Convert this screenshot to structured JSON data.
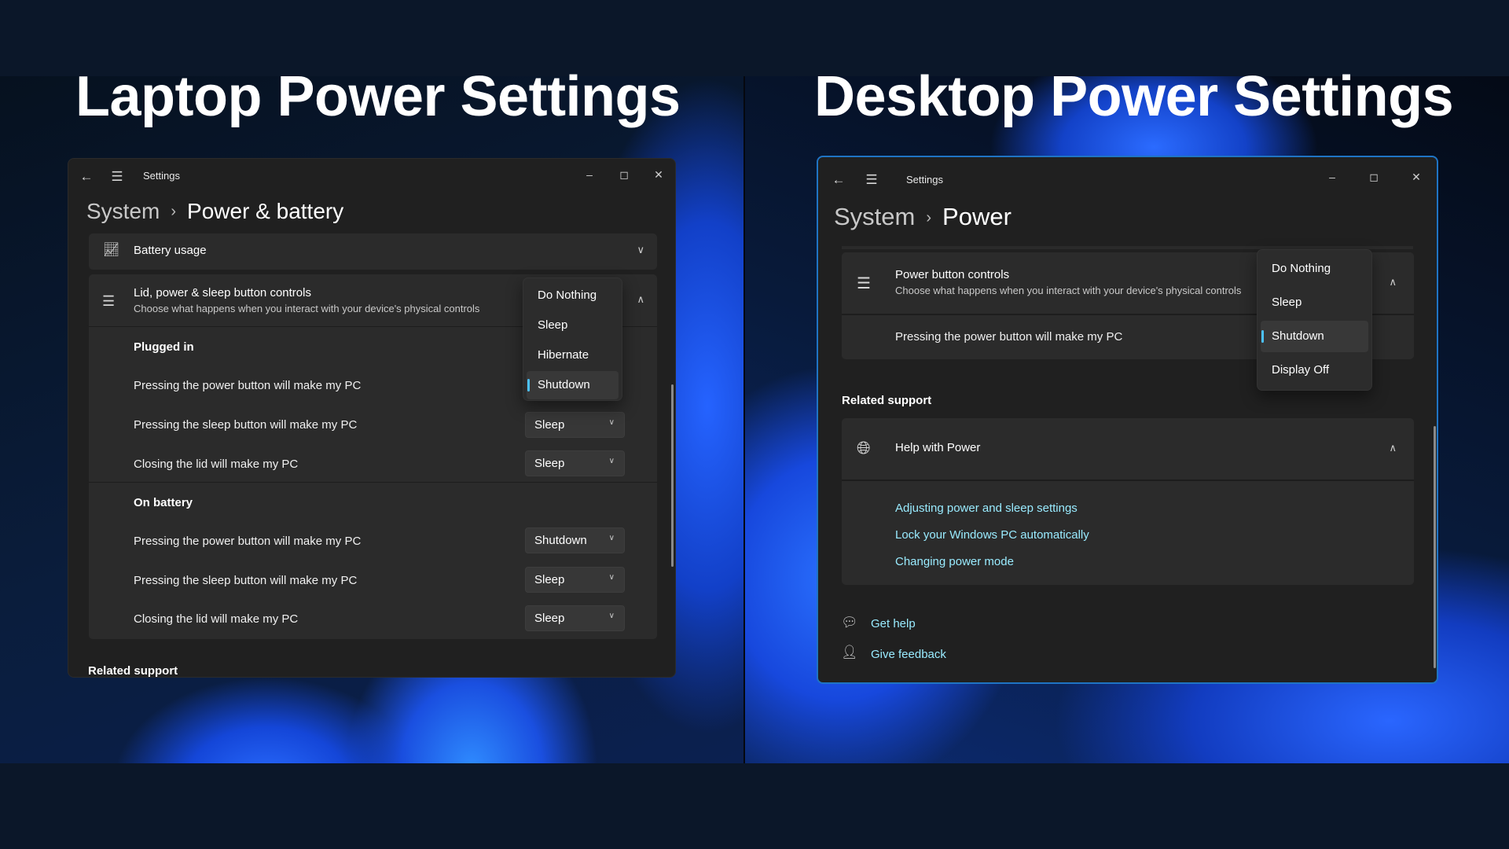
{
  "headlines": {
    "left": "Laptop Power Settings",
    "right": "Desktop Power Settings"
  },
  "laptop": {
    "window_title": "Settings",
    "breadcrumb": {
      "parent": "System",
      "current": "Power & battery"
    },
    "battery_usage": {
      "label": "Battery usage"
    },
    "controls_card": {
      "title": "Lid, power & sleep button controls",
      "subtitle": "Choose what happens when you interact with your device's physical controls"
    },
    "plugged_in": {
      "label": "Plugged in",
      "rows": [
        {
          "label": "Pressing the power button will make my PC",
          "value": "Shutdown"
        },
        {
          "label": "Pressing the sleep button will make my PC",
          "value": "Sleep"
        },
        {
          "label": "Closing the lid will make my PC",
          "value": "Sleep"
        }
      ]
    },
    "on_battery": {
      "label": "On battery",
      "rows": [
        {
          "label": "Pressing the power button will make my PC",
          "value": "Shutdown"
        },
        {
          "label": "Pressing the sleep button will make my PC",
          "value": "Sleep"
        },
        {
          "label": "Closing the lid will make my PC",
          "value": "Sleep"
        }
      ]
    },
    "open_menu": {
      "options": [
        "Do Nothing",
        "Sleep",
        "Hibernate",
        "Shutdown"
      ],
      "selected": "Shutdown"
    },
    "related_support": "Related support"
  },
  "desktop": {
    "window_title": "Settings",
    "breadcrumb": {
      "parent": "System",
      "current": "Power"
    },
    "controls_card": {
      "title": "Power button controls",
      "subtitle": "Choose what happens when you interact with your device's physical controls"
    },
    "row": {
      "label": "Pressing the power button will make my PC",
      "value": "Shutdown"
    },
    "open_menu": {
      "options": [
        "Do Nothing",
        "Sleep",
        "Shutdown",
        "Display Off"
      ],
      "selected": "Shutdown"
    },
    "related_support": "Related support",
    "help": {
      "title": "Help with Power",
      "links": [
        "Adjusting power and sleep settings",
        "Lock your Windows PC automatically",
        "Changing power mode"
      ]
    },
    "footer": {
      "get_help": "Get help",
      "give_feedback": "Give feedback"
    }
  },
  "colors": {
    "accent": "#4cc2ff",
    "link": "#99ebff",
    "window_border_active": "#1f74c4"
  }
}
